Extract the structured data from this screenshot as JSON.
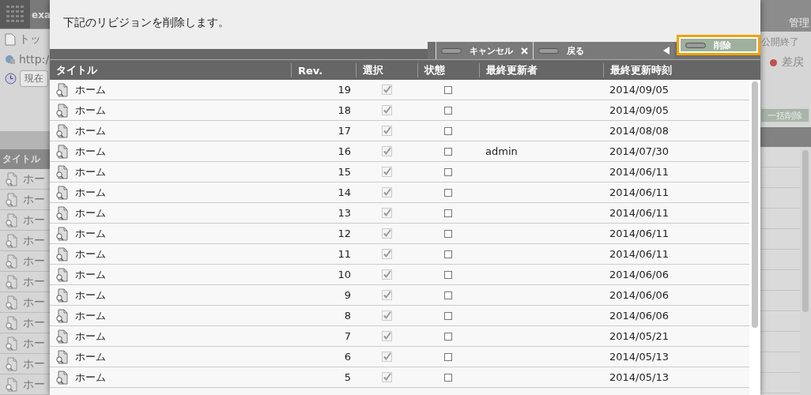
{
  "background": {
    "logo_text": "exa",
    "links": [
      {
        "kind": "page",
        "label": "トッ"
      },
      {
        "kind": "url",
        "label": "http:/"
      }
    ],
    "time_button": "現在",
    "list_header": "タイトル",
    "list_rows": [
      "ホー",
      "ホー",
      "ホー",
      "ホー",
      "ホー",
      "ホー",
      "ホー",
      "ホー",
      "ホー",
      "ホー",
      "ホー"
    ],
    "menu": "管理",
    "actions": [
      {
        "kind": "plain",
        "label": "公開終了"
      },
      {
        "kind": "dot",
        "label": "差戻"
      }
    ],
    "bulk_button": "一括削除"
  },
  "dialog": {
    "message": "下記のリビジョンを削除します。",
    "buttons": [
      {
        "label": "キャンセル",
        "kind": "close",
        "focused": false
      },
      {
        "label": "戻る",
        "kind": "back",
        "focused": false
      },
      {
        "label": "削除",
        "kind": "plain",
        "focused": true
      }
    ],
    "columns": [
      "タイトル",
      "Rev.",
      "選択",
      "状態",
      "最終更新者",
      "最終更新時刻"
    ],
    "rows": [
      {
        "title": "ホーム",
        "rev": "19",
        "selected": true,
        "status": false,
        "updater": "",
        "date": "2014/09/05"
      },
      {
        "title": "ホーム",
        "rev": "18",
        "selected": true,
        "status": false,
        "updater": "",
        "date": "2014/09/05"
      },
      {
        "title": "ホーム",
        "rev": "17",
        "selected": true,
        "status": false,
        "updater": "",
        "date": "2014/08/08"
      },
      {
        "title": "ホーム",
        "rev": "16",
        "selected": true,
        "status": false,
        "updater": "admin",
        "date": "2014/07/30"
      },
      {
        "title": "ホーム",
        "rev": "15",
        "selected": true,
        "status": false,
        "updater": "",
        "date": "2014/06/11"
      },
      {
        "title": "ホーム",
        "rev": "14",
        "selected": true,
        "status": false,
        "updater": "",
        "date": "2014/06/11"
      },
      {
        "title": "ホーム",
        "rev": "13",
        "selected": true,
        "status": false,
        "updater": "",
        "date": "2014/06/11"
      },
      {
        "title": "ホーム",
        "rev": "12",
        "selected": true,
        "status": false,
        "updater": "",
        "date": "2014/06/11"
      },
      {
        "title": "ホーム",
        "rev": "11",
        "selected": true,
        "status": false,
        "updater": "",
        "date": "2014/06/11"
      },
      {
        "title": "ホーム",
        "rev": "10",
        "selected": true,
        "status": false,
        "updater": "",
        "date": "2014/06/06"
      },
      {
        "title": "ホーム",
        "rev": "9",
        "selected": true,
        "status": false,
        "updater": "",
        "date": "2014/06/06"
      },
      {
        "title": "ホーム",
        "rev": "8",
        "selected": true,
        "status": false,
        "updater": "",
        "date": "2014/06/06"
      },
      {
        "title": "ホーム",
        "rev": "7",
        "selected": true,
        "status": false,
        "updater": "",
        "date": "2014/05/21"
      },
      {
        "title": "ホーム",
        "rev": "6",
        "selected": true,
        "status": false,
        "updater": "",
        "date": "2014/05/13"
      },
      {
        "title": "ホーム",
        "rev": "5",
        "selected": true,
        "status": false,
        "updater": "",
        "date": "2014/05/13"
      }
    ]
  }
}
